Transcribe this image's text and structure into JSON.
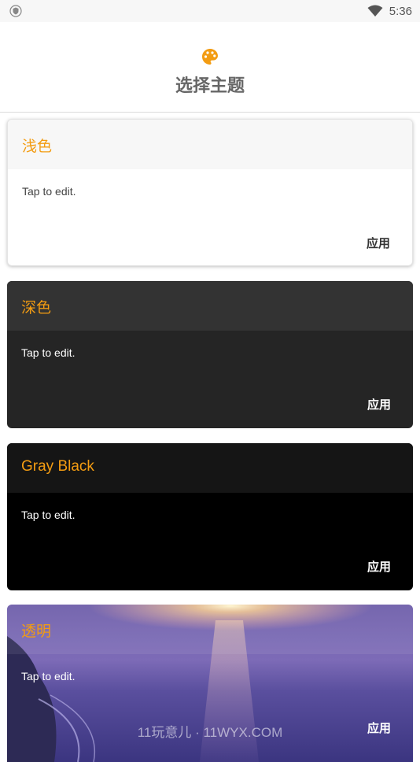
{
  "statusbar": {
    "time": "5:36",
    "left_icon": "shield-icon",
    "right_icon": "wifi-icon"
  },
  "header": {
    "icon": "palette-icon",
    "title": "选择主题",
    "icon_color": "#f39c12"
  },
  "themes": [
    {
      "name": "浅色",
      "body": "Tap to edit.",
      "apply_label": "应用"
    },
    {
      "name": "深色",
      "body": "Tap to edit.",
      "apply_label": "应用"
    },
    {
      "name": "Gray Black",
      "body": "Tap to edit.",
      "apply_label": "应用"
    },
    {
      "name": "透明",
      "body": "Tap to edit.",
      "apply_label": "应用"
    }
  ],
  "watermark": "11玩意儿 · 11WYX.COM",
  "colors": {
    "accent": "#f39c12",
    "dark_card": "#252525",
    "gray_black_card": "#000000"
  }
}
